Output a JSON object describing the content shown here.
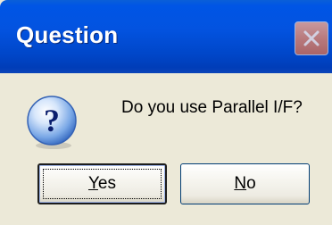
{
  "window": {
    "title": "Question"
  },
  "dialog": {
    "message": "Do you use Parallel I/F?",
    "icon": "question-icon"
  },
  "buttons": {
    "yes": {
      "accel": "Y",
      "rest": "es"
    },
    "no": {
      "accel": "N",
      "rest": "o"
    }
  },
  "colors": {
    "titlebar": "#0353E0",
    "dialog_bg": "#ECE9D8",
    "close_button": "#D9826E",
    "button_border": "#003C74"
  }
}
